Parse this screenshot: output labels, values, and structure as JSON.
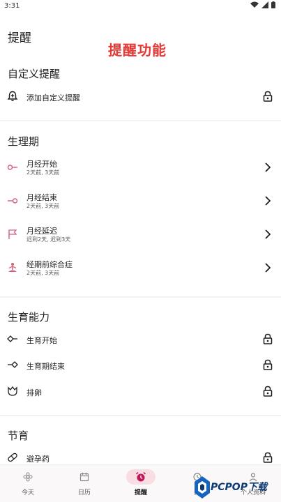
{
  "status_bar": {
    "time": "3:31"
  },
  "header": {
    "title": "提醒",
    "promo_text": "提醒功能"
  },
  "sections": {
    "custom": {
      "title": "自定义提醒",
      "items": [
        {
          "label": "添加自定义提醒",
          "icon": "bell-plus-icon",
          "action": "lock-icon"
        }
      ]
    },
    "period": {
      "title": "生理期",
      "items": [
        {
          "label": "月经开始",
          "sub": "2天前, 3天前",
          "icon": "period-start-icon",
          "action": "chevron-right-icon"
        },
        {
          "label": "月经结束",
          "sub": "2天前, 3天前",
          "icon": "period-end-icon",
          "action": "chevron-right-icon"
        },
        {
          "label": "月经延迟",
          "sub": "迟到2天, 迟到3天",
          "icon": "flag-icon",
          "action": "chevron-right-icon"
        },
        {
          "label": "经期前综合症",
          "sub": "2天前, 3天前",
          "icon": "meditation-icon",
          "action": "chevron-right-icon"
        }
      ]
    },
    "fertility": {
      "title": "生育能力",
      "items": [
        {
          "label": "生育开始",
          "icon": "fertile-start-icon",
          "action": "lock-icon"
        },
        {
          "label": "生育期结束",
          "icon": "fertile-end-icon",
          "action": "lock-icon"
        },
        {
          "label": "排卵",
          "icon": "tulip-icon",
          "action": "lock-icon"
        }
      ]
    },
    "contraception": {
      "title": "节育",
      "items": [
        {
          "label": "避孕药",
          "icon": "pill-icon",
          "action": "lock-icon"
        }
      ]
    }
  },
  "bottom_nav": {
    "items": [
      {
        "label": "今天",
        "icon": "flower-icon"
      },
      {
        "label": "日历",
        "icon": "calendar-icon"
      },
      {
        "label": "提醒",
        "icon": "alarm-clock-icon",
        "active": true
      },
      {
        "label": "真",
        "icon": "insights-icon"
      },
      {
        "label": "个人资料",
        "icon": "profile-icon"
      }
    ]
  },
  "watermark": {
    "text": "PCPOP下载"
  },
  "colors": {
    "accent": "#d0617a",
    "promo": "#e53935",
    "active_nav_bg": "#f8dde3"
  }
}
